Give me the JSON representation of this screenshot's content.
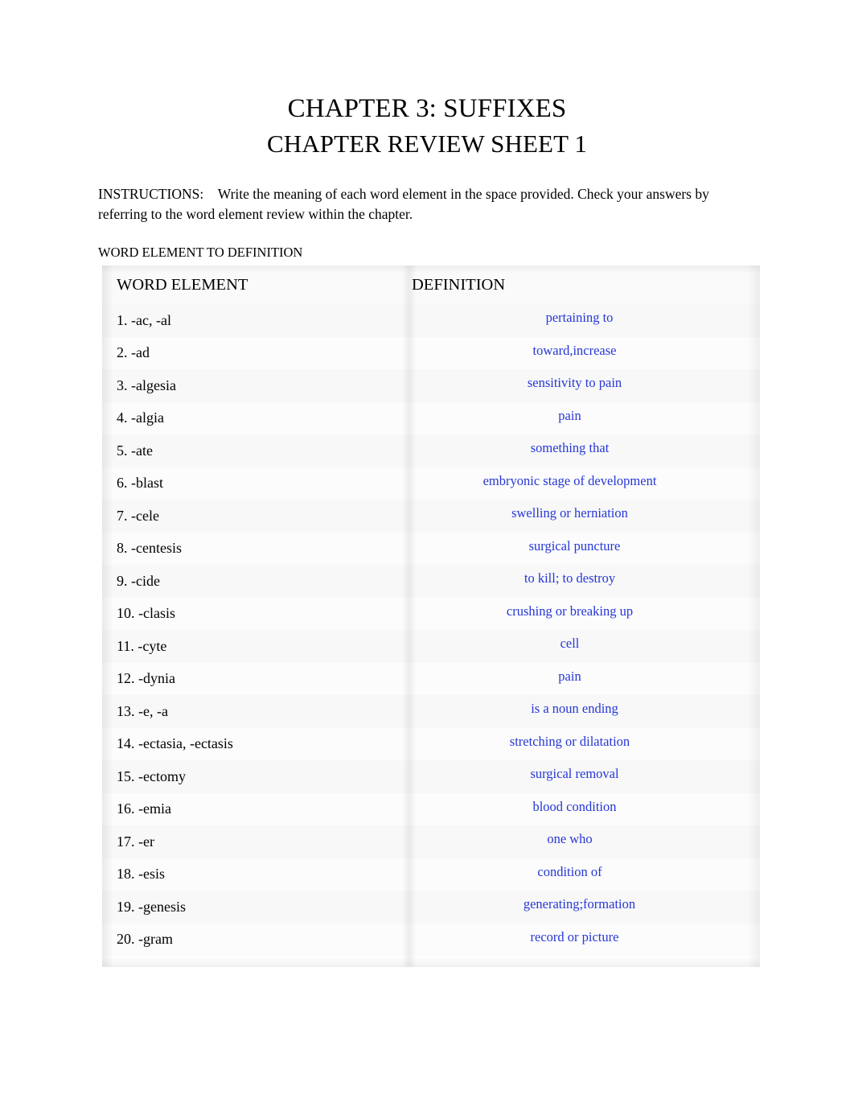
{
  "document": {
    "title_line1": "CHAPTER 3: SUFFIXES",
    "title_line2": "CHAPTER REVIEW SHEET 1",
    "instructions_label": "INSTRUCTIONS:",
    "instructions_text": "Write the meaning of each word element in the space provided. Check your answers by referring to the word element review within the chapter.",
    "section_label": "WORD ELEMENT TO DEFINITION",
    "answer_color": "#2637d6"
  },
  "table": {
    "headers": {
      "word_element": "WORD ELEMENT",
      "definition": "DEFINITION"
    },
    "rows": [
      {
        "element": "1. -ac, -al",
        "definition": "pertaining to"
      },
      {
        "element": "2. -ad",
        "definition": "toward,increase"
      },
      {
        "element": "3. -algesia",
        "definition": "sensitivity to pain"
      },
      {
        "element": "4. -algia",
        "definition": "pain"
      },
      {
        "element": "5. -ate",
        "definition": "something that"
      },
      {
        "element": "6. -blast",
        "definition": "embryonic stage of development"
      },
      {
        "element": "7. -cele",
        "definition": "swelling or herniation"
      },
      {
        "element": "8. -centesis",
        "definition": "surgical puncture"
      },
      {
        "element": "9. -cide",
        "definition": "to kill; to destroy"
      },
      {
        "element": "10. -clasis",
        "definition": "crushing or breaking up"
      },
      {
        "element": "11. -cyte",
        "definition": "cell"
      },
      {
        "element": "12. -dynia",
        "definition": "pain"
      },
      {
        "element": "13. -e, -a",
        "definition": "is a noun ending"
      },
      {
        "element": "14. -ectasia, -ectasis",
        "definition": "stretching or dilatation"
      },
      {
        "element": "15. -ectomy",
        "definition": "surgical removal"
      },
      {
        "element": "16. -emia",
        "definition": "blood condition"
      },
      {
        "element": "17. -er",
        "definition": "one who"
      },
      {
        "element": "18. -esis",
        "definition": "condition of"
      },
      {
        "element": "19. -genesis",
        "definition": "generating;formation"
      },
      {
        "element": "20. -gram",
        "definition": "record or picture"
      }
    ]
  }
}
